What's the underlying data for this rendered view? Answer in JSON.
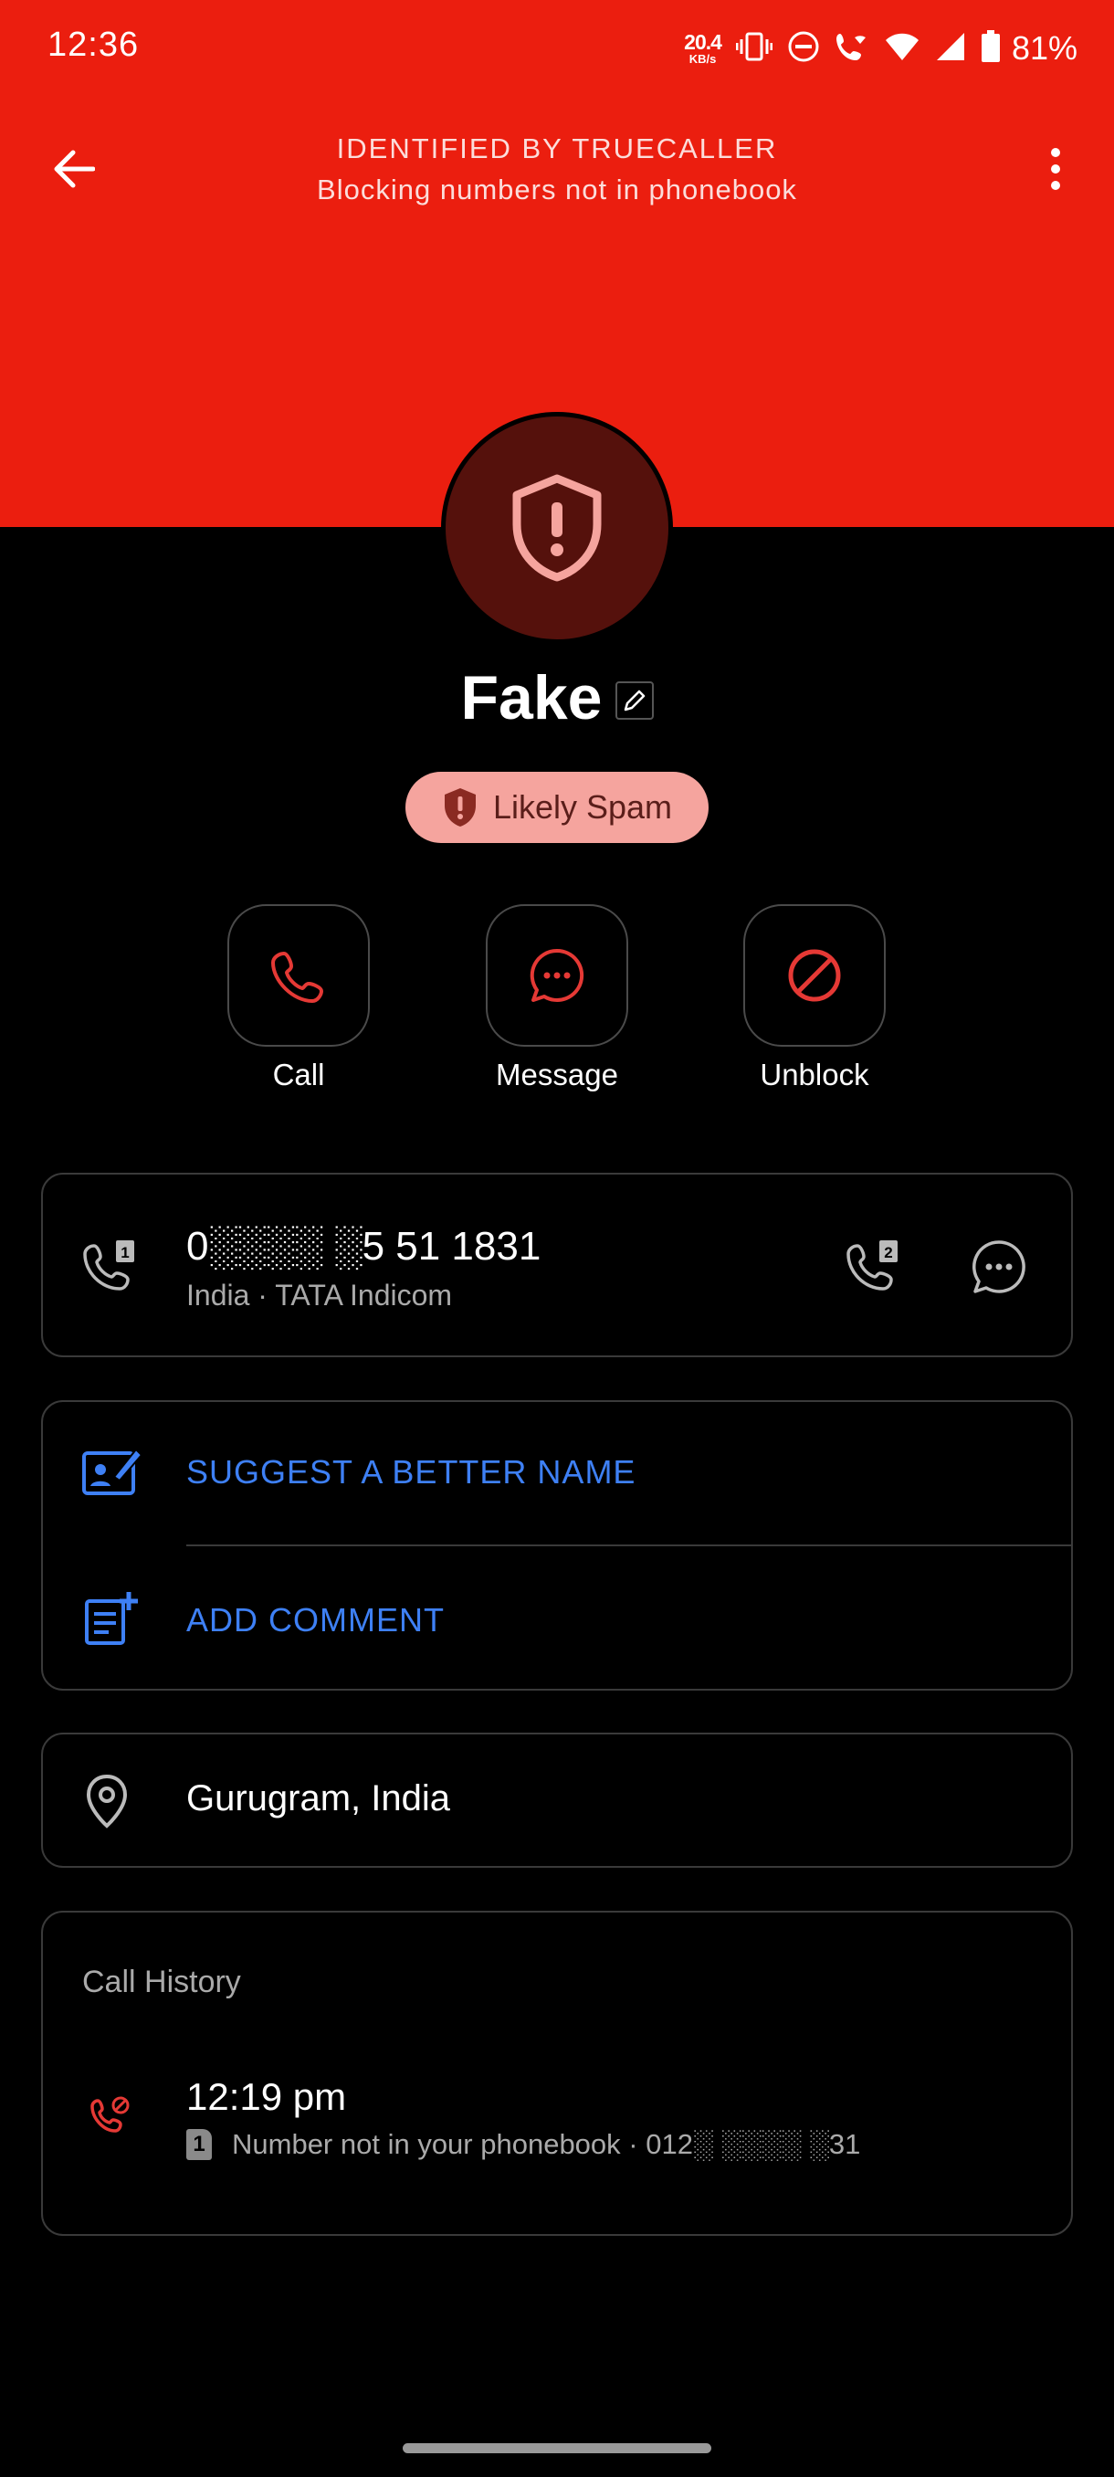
{
  "status_bar": {
    "time": "12:36",
    "net_speed_value": "20.4",
    "net_speed_unit": "KB/s",
    "battery": "81%"
  },
  "header": {
    "title": "IDENTIFIED BY TRUECALLER",
    "subtitle": "Blocking numbers not in phonebook"
  },
  "contact": {
    "name": "Fake",
    "badge": "Likely Spam"
  },
  "actions": {
    "call": "Call",
    "message": "Message",
    "unblock": "Unblock"
  },
  "phone": {
    "number": "0░░░░ ░5 51 1831",
    "details": "India · TATA Indicom",
    "sim_left": "1",
    "sim_right": "2"
  },
  "suggest": {
    "better_name": "SUGGEST A BETTER NAME",
    "add_comment": "ADD COMMENT"
  },
  "location": {
    "text": "Gurugram, India"
  },
  "call_history": {
    "title": "Call History",
    "entries": [
      {
        "time": "12:19 pm",
        "sim": "1",
        "details": "Number not in your phonebook · 012░ ░░░░ ░31"
      }
    ]
  },
  "colors": {
    "header_red": "#EB1E0F",
    "spam_badge": "#F5A49E",
    "link_blue": "#3E80F5",
    "action_red": "#E53935"
  }
}
